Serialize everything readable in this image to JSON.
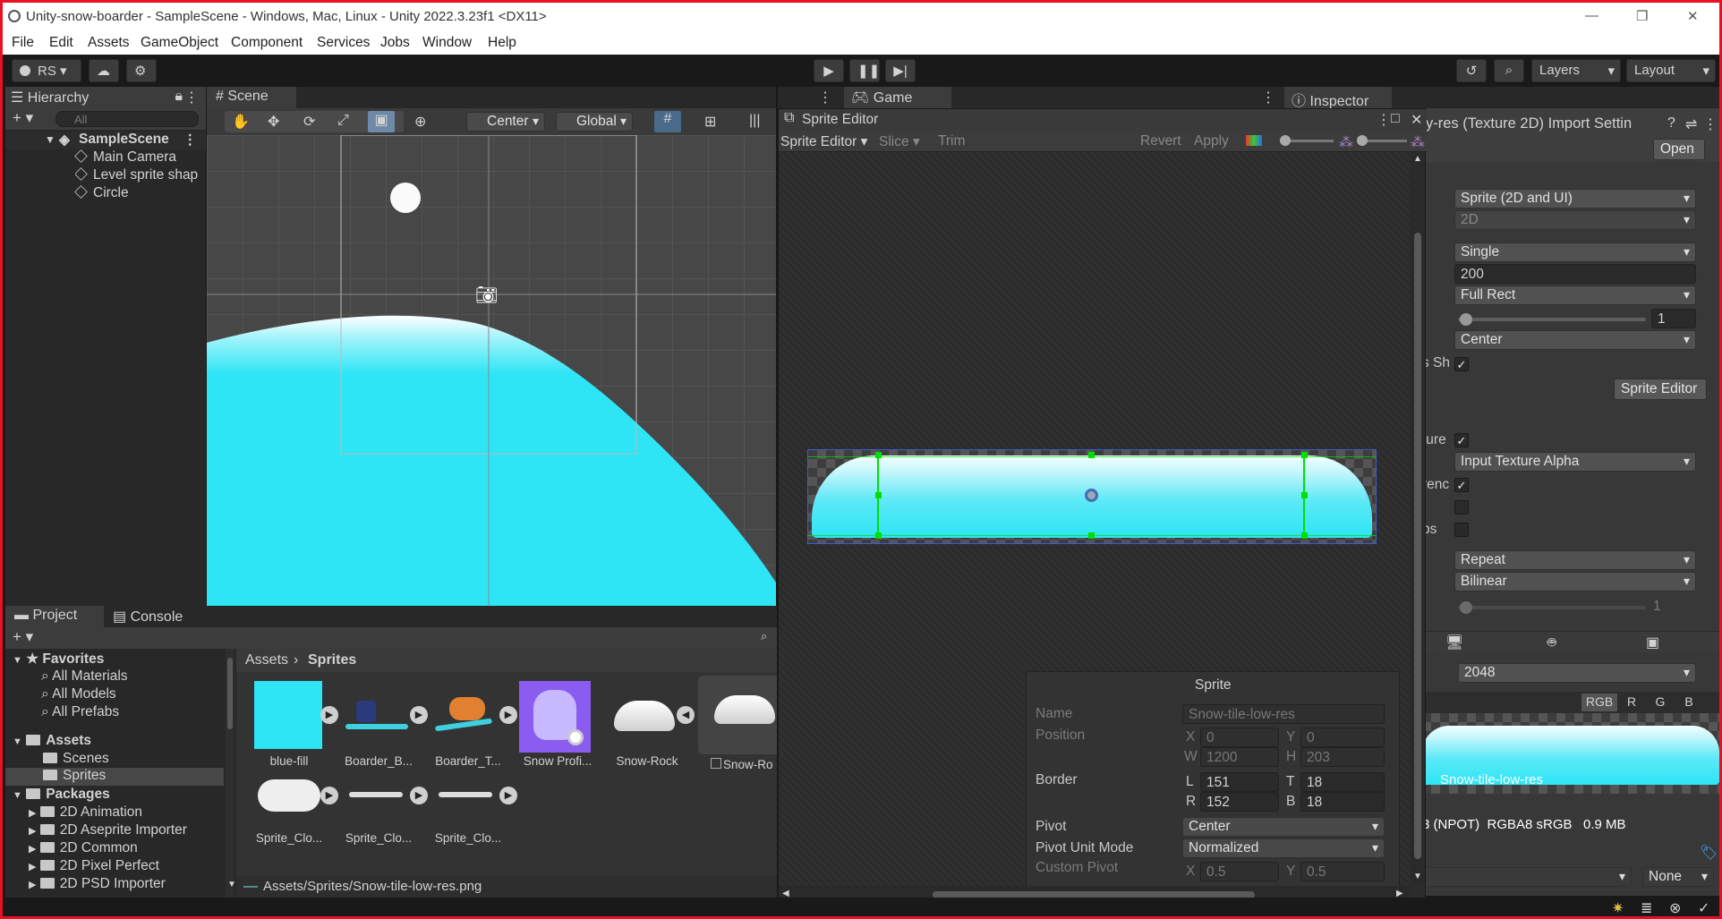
{
  "window": {
    "title": "Unity-snow-boarder - SampleScene - Windows, Mac, Linux - Unity 2022.3.23f1 <DX11>",
    "controls": [
      "—",
      "❐",
      "✕"
    ]
  },
  "menu": [
    "File",
    "Edit",
    "Assets",
    "GameObject",
    "Component",
    "Services",
    "Jobs",
    "Window",
    "Help"
  ],
  "toolbar": {
    "account": "RS",
    "layers": "Layers",
    "layout": "Layout"
  },
  "hierarchy": {
    "tab": "Hierarchy",
    "search_placeholder": "All",
    "scene": "SampleScene",
    "items": [
      "Main Camera",
      "Level sprite shap",
      "Circle"
    ]
  },
  "scene": {
    "tab": "Scene",
    "pivot": "Center",
    "space": "Global"
  },
  "game": {
    "tab": "Game"
  },
  "inspector": {
    "tab": "Inspector",
    "header": "y-res (Texture 2D) Import Settin",
    "open_button": "Open",
    "texture_type": "Sprite (2D and UI)",
    "texture_shape": "2D",
    "sprite_mode": "Single",
    "pixels_per_unit": "200",
    "mesh_type": "Full Rect",
    "extrude_edges": "1",
    "pivot": "Center",
    "label_ps": "s Sh",
    "sprite_editor_button": "Sprite Editor",
    "label_texture": "ture",
    "alpha_source": "Input Texture Alpha",
    "label_trans": "renc",
    "label_mips": "ps",
    "wrap_mode": "Repeat",
    "filter_mode": "Bilinear",
    "aniso": "1",
    "max_size": "2048",
    "channels": [
      "RGB",
      "R",
      "G",
      "B"
    ],
    "preview_name": "Snow-tile-low-res",
    "preview_info": "3 (NPOT)  RGBA8 sRGB   0.9 MB",
    "asset_bundle": "None"
  },
  "sprite_editor": {
    "title": "Sprite Editor",
    "menu": "Sprite Editor",
    "slice": "Slice",
    "trim": "Trim",
    "revert": "Revert",
    "apply": "Apply",
    "panel_title": "Sprite",
    "name_label": "Name",
    "name_value": "Snow-tile-low-res",
    "position_label": "Position",
    "x_label": "X",
    "x_value": "0",
    "y_label": "Y",
    "y_value": "0",
    "w_label": "W",
    "w_value": "1200",
    "h_label": "H",
    "h_value": "203",
    "border_label": "Border",
    "l_label": "L",
    "l_value": "151",
    "t_label": "T",
    "t_value": "18",
    "r_label": "R",
    "r_value": "152",
    "b_label": "B",
    "b_value": "18",
    "pivot_label": "Pivot",
    "pivot_value": "Center",
    "pivot_unit_label": "Pivot Unit Mode",
    "pivot_unit_value": "Normalized",
    "custom_pivot_label": "Custom Pivot",
    "cx_label": "X",
    "cx_value": "0.5",
    "cy_label": "Y",
    "cy_value": "0.5"
  },
  "project": {
    "tab": "Project",
    "console_tab": "Console",
    "favorites": "Favorites",
    "fav_items": [
      "All Materials",
      "All Models",
      "All Prefabs"
    ],
    "assets": "Assets",
    "asset_folders": [
      "Scenes",
      "Sprites"
    ],
    "packages": "Packages",
    "package_items": [
      "2D Animation",
      "2D Aseprite Importer",
      "2D Common",
      "2D Pixel Perfect",
      "2D PSD Importer"
    ],
    "breadcrumb_root": "Assets",
    "breadcrumb_current": "Sprites",
    "asset_tiles": [
      "blue-fill",
      "Boarder_B...",
      "Boarder_T...",
      "Snow Profi...",
      "Snow-Rock",
      "Snow-Ro",
      "Sprite_Clo...",
      "Sprite_Clo...",
      "Sprite_Clo..."
    ],
    "path": "Assets/Sprites/Snow-tile-low-res.png"
  }
}
